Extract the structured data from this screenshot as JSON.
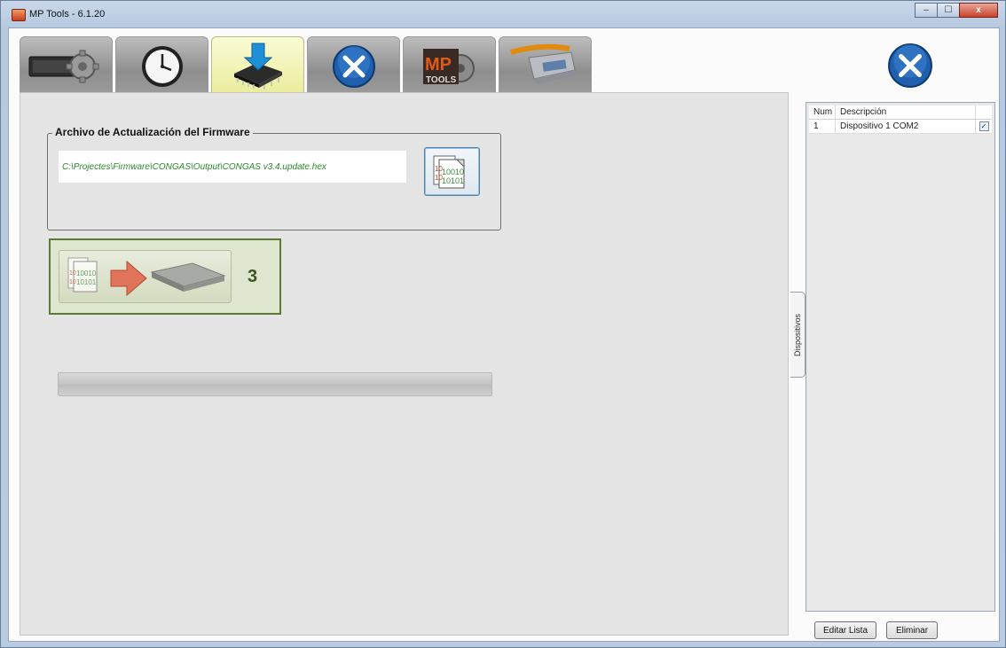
{
  "window": {
    "title": "MP Tools - 6.1.20",
    "controls": {
      "minimize": "‒",
      "maximize": "☐",
      "close": "x"
    }
  },
  "tabs": [
    {
      "name": "config",
      "icon": "device-gear-icon",
      "active": false
    },
    {
      "name": "clock",
      "icon": "clock-icon",
      "active": false
    },
    {
      "name": "firmware",
      "icon": "chip-download-icon",
      "active": true
    },
    {
      "name": "tools",
      "icon": "tools-icon",
      "active": false
    },
    {
      "name": "mp-tools",
      "icon": "mp-tools-logo-icon",
      "active": false
    },
    {
      "name": "serial",
      "icon": "serial-cable-icon",
      "active": false
    }
  ],
  "firmware": {
    "group_title": "Archivo de Actualización del Firmware",
    "file_path": "C:\\Projectes\\Firmware\\CONGAS\\Output\\CONGAS v3.4.update.hex",
    "browse_icon": "binary-file-icon",
    "flash_icon": "flash-to-chip-icon",
    "flash_count": "3",
    "progress": 0
  },
  "side_tab": {
    "label": "Dispositivos"
  },
  "devices": {
    "columns": {
      "num": "Num",
      "description": "Descripción"
    },
    "rows": [
      {
        "num": "1",
        "description": "Dispositivo 1 COM2",
        "checked": true
      }
    ],
    "edit_label": "Editar Lista",
    "delete_label": "Eliminar"
  },
  "colors": {
    "active_tab": "#eef0a8",
    "path_text": "#2a8a2a",
    "flash_border": "#5d7a35"
  }
}
